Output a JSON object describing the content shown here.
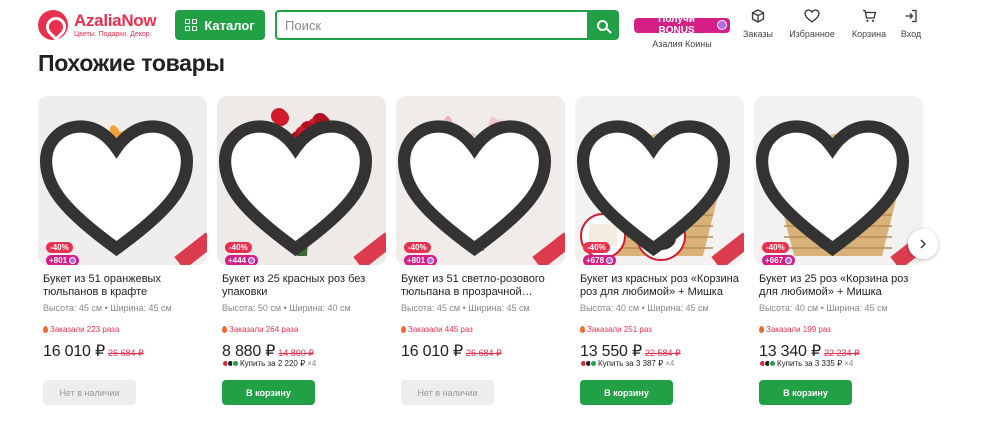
{
  "brand": {
    "name": "AzaliaNow",
    "tagline": "Цветы. Подарки. Декор."
  },
  "header": {
    "catalog_label": "Каталог",
    "search_placeholder": "Поиск",
    "bonus_pill": "Получи BONUS",
    "bonus_label": "Азалия Коины",
    "nav": [
      {
        "label": "Заказы",
        "icon": "box-icon"
      },
      {
        "label": "Избранное",
        "icon": "heart-icon"
      },
      {
        "label": "Корзина",
        "icon": "cart-icon"
      },
      {
        "label": "Вход",
        "icon": "login-icon"
      }
    ]
  },
  "section": {
    "title": "Похожие товары"
  },
  "colors": {
    "accent_green": "#22a046",
    "brand_red": "#e8304f",
    "bonus_pink": "#d41f86"
  },
  "products": [
    {
      "title": "Букет из 51 оранжевых тюльпанов в крафте",
      "dims": "Высота: 45 см • Ширина: 45 см",
      "orders": "Заказали 223 раза",
      "price": "16 010 ₽",
      "old_price": "26 684 ₽",
      "discount": "-40%",
      "bonus": "+801",
      "split": "",
      "split_more": "",
      "button": "Нет в наличии",
      "in_stock": false,
      "image": "orange-tulips"
    },
    {
      "title": "Букет из 25 красных роз без упаковки",
      "dims": "Высота: 50 см • Ширина: 40 см",
      "orders": "Заказали 264 раза",
      "price": "8 880 ₽",
      "old_price": "14 800 ₽",
      "discount": "-40%",
      "bonus": "+444",
      "split": "Купить за 2 220 ₽",
      "split_more": "×4",
      "button": "В корзину",
      "in_stock": true,
      "image": "red-roses"
    },
    {
      "title": "Букет из 51 светло-розового тюльпана в прозрачной…",
      "dims": "Высота: 45 см • Ширина: 45 см",
      "orders": "Заказали 445 раз",
      "price": "16 010 ₽",
      "old_price": "26 684 ₽",
      "discount": "-40%",
      "bonus": "+801",
      "split": "",
      "split_more": "",
      "button": "Нет в наличии",
      "in_stock": false,
      "image": "pink-tulips"
    },
    {
      "title": "Букет из красных роз «Корзина роз для любимой» + Мишка +…",
      "dims": "Высота: 40 см • Ширина: 45 см",
      "orders": "Заказали 251 раз",
      "price": "13 550 ₽",
      "old_price": "22 584 ₽",
      "discount": "-40%",
      "bonus": "+678",
      "split": "Купить за 3 387 ₽",
      "split_more": "×4",
      "button": "В корзину",
      "in_stock": true,
      "image": "rose-basket-bear"
    },
    {
      "title": "Букет из 25 роз «Корзина роз для любимой» + Мишка",
      "dims": "Высота: 40 см • Ширина: 45 см",
      "orders": "Заказали 199 раз",
      "price": "13 340 ₽",
      "old_price": "22 234 ₽",
      "discount": "-40%",
      "bonus": "+667",
      "split": "Купить за 3 335 ₽",
      "split_more": "×4",
      "button": "В корзину",
      "in_stock": true,
      "image": "rose-basket"
    }
  ]
}
